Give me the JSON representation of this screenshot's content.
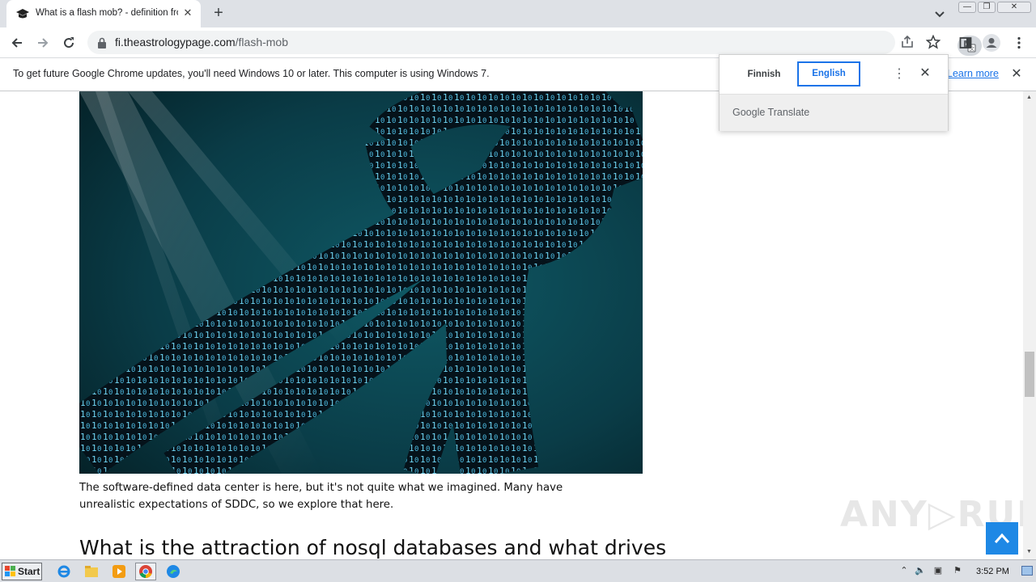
{
  "tab": {
    "title": "What is a flash mob? - definition from",
    "close": "✕"
  },
  "new_tab": "+",
  "window": {
    "minimize": "—",
    "restore": "❐",
    "close": "✕"
  },
  "toolbar": {
    "url_host": "fi.theastrologypage.com",
    "url_path": "/flash-mob"
  },
  "infobar": {
    "message": "To get future Google Chrome updates, you'll need Windows 10 or later. This computer is using Windows 7.",
    "learn_more": "Learn more",
    "close": "✕"
  },
  "translate": {
    "source_lang": "Finnish",
    "target_lang": "English",
    "menu": "⋮",
    "close": "✕",
    "brand": "Google Translate"
  },
  "article": {
    "caption": "The software-defined data center is here, but it's not quite what we imagined. Many have unrealistic expectations of SDDC, so we explore that here.",
    "heading": "What is the attraction of nosql databases and what drives"
  },
  "watermark": "ANY RUN",
  "taskbar": {
    "start": "Start",
    "clock": "3:52 PM"
  },
  "colors": {
    "accent": "#1a73e8",
    "to_top": "#1e88e5",
    "image_bg": "#0a3a44"
  }
}
